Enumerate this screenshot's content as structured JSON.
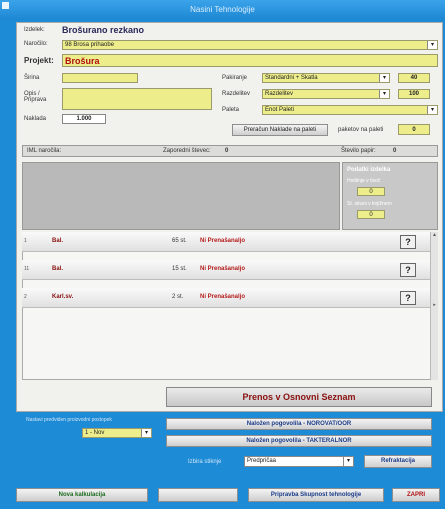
{
  "window": {
    "title": "Nasini Tehnologije"
  },
  "header": {
    "izdelek_label": "Izdelek:",
    "izdelek_value": "Brošurano rezkano"
  },
  "narocilo": {
    "label": "Naročilo:",
    "value": "98 Brosa prihaobe"
  },
  "projekt": {
    "label": "Projekt:",
    "value": "Brošura"
  },
  "left_fields": {
    "sirina_label": "Širina",
    "opis_label": "Opis / Pripravа",
    "naklada_label": "Naklada",
    "naklada_value": "1.000"
  },
  "right_fields": {
    "pakiranje_label": "Pakiranje",
    "pakiranje_value": "Standardni + Škatla",
    "pakiranje_num": "40",
    "razdelitev_label": "Razdelitev",
    "razdelitev_value": "Razdelitev",
    "razdelitev_num": "100",
    "paleta_label": "Paleta",
    "paleta_value": "Enot Paleti"
  },
  "calc": {
    "button_label": "Preračun Naklade na paleti",
    "count_label": "paketov na paleti",
    "count_value": "0"
  },
  "info_bar": {
    "left": "IML naročila:",
    "middle_label": "Zaporedni števec:",
    "middle_value": "0",
    "right_label": "Število papir:",
    "right_value": "0"
  },
  "side_panel": {
    "title": "Podatki izdelka",
    "field1_label": "Hotilinje v tisoč",
    "field1_value": "0",
    "field2_label": "St. strani v knjižnem",
    "field2_value": "0"
  },
  "rows": [
    {
      "num": "1",
      "kind": "Bal.",
      "qty": "65 st.",
      "status": "Ni Prenašanaljo"
    },
    {
      "num": "11",
      "kind": "Bal.",
      "qty": "15 st.",
      "status": "Ni Prenašanaljo"
    },
    {
      "num": "2",
      "kind": "Karl.sv.",
      "qty": "2 st.",
      "status": "Ni Prenašanaljo"
    }
  ],
  "actions": {
    "prenos_label": "Prenos v Osnovni Seznam",
    "small_label": "Nastavi predviden proizvodni postopek",
    "small_select": "1 - Nov",
    "btn1": "Naložen pogovolila - NOROVAT/OOR",
    "btn2": "Naložen pogovolila - TAKTERALNOR",
    "izbira_label": "Izbira stiknje",
    "izbira_value": "Predpričaa",
    "refresh_label": "Refraktacija"
  },
  "bottom": {
    "new_label": "Nova kalkulacija",
    "prep_label": "Pripravba Skupnost tehnologije",
    "close_label": "ZAPRI"
  }
}
